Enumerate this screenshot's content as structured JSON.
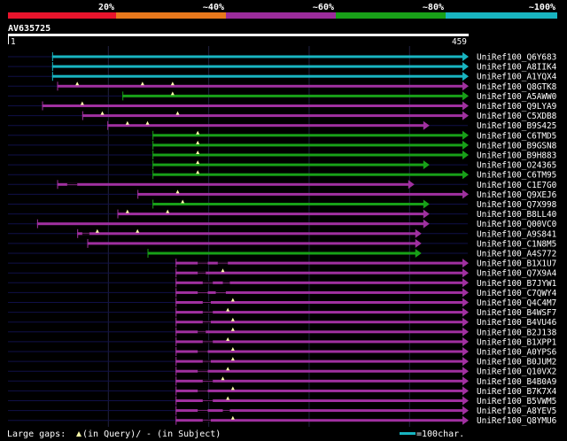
{
  "colors": {
    "background": "#000000",
    "bands": [
      "#e8142c",
      "#e8781c",
      "#9c2c9c",
      "#18a018",
      "#18b4c0"
    ],
    "hit_colors": {
      "cyan": "#18b4c0",
      "green": "#18a018",
      "purple": "#a030a0"
    },
    "track": "#101048",
    "gap_marker": "#ffffaa"
  },
  "identity_legend": [
    {
      "label": "20%",
      "color": "#e8142c"
    },
    {
      "label": "~40%",
      "color": "#e8781c"
    },
    {
      "label": "~60%",
      "color": "#9c2c9c"
    },
    {
      "label": "~80%",
      "color": "#18a018"
    },
    {
      "label": "~100%",
      "color": "#18b4c0"
    }
  ],
  "query": {
    "id": "AV635725",
    "start_label": "1",
    "end_label": "459",
    "length": 459
  },
  "footer": {
    "gaps_prefix": "Large gaps: ",
    "gaps_query_text": "(in Query)/",
    "gaps_subject_text": "- (in Subject)",
    "scale_text": "=100char."
  },
  "chart_data": {
    "type": "alignment",
    "x_axis": {
      "min": 1,
      "max": 459,
      "unit": "residue"
    },
    "hits": [
      {
        "name": "UniRef100_Q6Y683",
        "start": 45,
        "end": 459,
        "color": "cyan",
        "q_gaps": [],
        "s_gaps": []
      },
      {
        "name": "UniRef100_A8IIK4",
        "start": 45,
        "end": 459,
        "color": "cyan",
        "q_gaps": [],
        "s_gaps": []
      },
      {
        "name": "UniRef100_A1YQX4",
        "start": 45,
        "end": 459,
        "color": "cyan",
        "q_gaps": [],
        "s_gaps": []
      },
      {
        "name": "UniRef100_Q8GTK8",
        "start": 50,
        "end": 459,
        "color": "purple",
        "q_gaps": [
          70,
          135,
          165
        ],
        "s_gaps": []
      },
      {
        "name": "UniRef100_A5AWW0",
        "start": 115,
        "end": 459,
        "color": "green",
        "q_gaps": [
          165
        ],
        "s_gaps": []
      },
      {
        "name": "UniRef100_Q9LYA9",
        "start": 35,
        "end": 459,
        "color": "purple",
        "q_gaps": [
          75
        ],
        "s_gaps": []
      },
      {
        "name": "UniRef100_C5XDB8",
        "start": 75,
        "end": 459,
        "color": "purple",
        "q_gaps": [
          95,
          170
        ],
        "s_gaps": []
      },
      {
        "name": "UniRef100_B9S425",
        "start": 100,
        "end": 420,
        "color": "purple",
        "q_gaps": [
          120,
          140
        ],
        "s_gaps": []
      },
      {
        "name": "UniRef100_C6TMD5",
        "start": 145,
        "end": 459,
        "color": "green",
        "q_gaps": [
          190
        ],
        "s_gaps": []
      },
      {
        "name": "UniRef100_B9GSN8",
        "start": 145,
        "end": 459,
        "color": "green",
        "q_gaps": [
          190
        ],
        "s_gaps": []
      },
      {
        "name": "UniRef100_B9H883",
        "start": 145,
        "end": 459,
        "color": "green",
        "q_gaps": [
          190
        ],
        "s_gaps": []
      },
      {
        "name": "UniRef100_O24365",
        "start": 145,
        "end": 420,
        "color": "green",
        "q_gaps": [
          190
        ],
        "s_gaps": []
      },
      {
        "name": "UniRef100_C6TM95",
        "start": 145,
        "end": 459,
        "color": "green",
        "q_gaps": [
          190
        ],
        "s_gaps": []
      },
      {
        "name": "UniRef100_C1E7G0",
        "start": 50,
        "end": 405,
        "color": "purple",
        "q_gaps": [],
        "s_gaps": [
          [
            60,
            70
          ]
        ]
      },
      {
        "name": "UniRef100_Q9XEJ6",
        "start": 130,
        "end": 459,
        "color": "purple",
        "q_gaps": [
          170
        ],
        "s_gaps": []
      },
      {
        "name": "UniRef100_Q7X998",
        "start": 145,
        "end": 420,
        "color": "green",
        "q_gaps": [
          175
        ],
        "s_gaps": []
      },
      {
        "name": "UniRef100_B8LL40",
        "start": 110,
        "end": 420,
        "color": "purple",
        "q_gaps": [
          120,
          160
        ],
        "s_gaps": []
      },
      {
        "name": "UniRef100_Q00VC0",
        "start": 30,
        "end": 420,
        "color": "purple",
        "q_gaps": [],
        "s_gaps": []
      },
      {
        "name": "UniRef100_A9S841",
        "start": 70,
        "end": 412,
        "color": "purple",
        "q_gaps": [
          90,
          130
        ],
        "s_gaps": [
          [
            75,
            82
          ]
        ]
      },
      {
        "name": "UniRef100_C1N8M5",
        "start": 80,
        "end": 412,
        "color": "purple",
        "q_gaps": [],
        "s_gaps": []
      },
      {
        "name": "UniRef100_A4S772",
        "start": 140,
        "end": 412,
        "color": "green",
        "q_gaps": [],
        "s_gaps": []
      },
      {
        "name": "UniRef100_B1X1U7",
        "start": 168,
        "end": 459,
        "color": "purple",
        "q_gaps": [],
        "s_gaps": [
          [
            190,
            200
          ],
          [
            210,
            220
          ]
        ]
      },
      {
        "name": "UniRef100_Q7X9A4",
        "start": 168,
        "end": 459,
        "color": "purple",
        "q_gaps": [
          215
        ],
        "s_gaps": [
          [
            190,
            198
          ]
        ]
      },
      {
        "name": "UniRef100_B7JYW1",
        "start": 168,
        "end": 459,
        "color": "purple",
        "q_gaps": [],
        "s_gaps": [
          [
            195,
            205
          ],
          [
            215,
            222
          ]
        ]
      },
      {
        "name": "UniRef100_C7QWY4",
        "start": 168,
        "end": 459,
        "color": "purple",
        "q_gaps": [],
        "s_gaps": [
          [
            190,
            200
          ],
          [
            208,
            218
          ]
        ]
      },
      {
        "name": "UniRef100_Q4C4M7",
        "start": 168,
        "end": 459,
        "color": "purple",
        "q_gaps": [
          225
        ],
        "s_gaps": [
          [
            195,
            203
          ]
        ]
      },
      {
        "name": "UniRef100_B4WSF7",
        "start": 168,
        "end": 459,
        "color": "purple",
        "q_gaps": [
          220
        ],
        "s_gaps": [
          [
            195,
            205
          ]
        ]
      },
      {
        "name": "UniRef100_B4VU46",
        "start": 168,
        "end": 459,
        "color": "purple",
        "q_gaps": [
          225
        ],
        "s_gaps": [
          [
            195,
            203
          ]
        ]
      },
      {
        "name": "UniRef100_B2J138",
        "start": 168,
        "end": 459,
        "color": "purple",
        "q_gaps": [
          225
        ],
        "s_gaps": [
          [
            190,
            198
          ]
        ]
      },
      {
        "name": "UniRef100_B1XPP1",
        "start": 168,
        "end": 459,
        "color": "purple",
        "q_gaps": [
          220
        ],
        "s_gaps": [
          [
            195,
            205
          ]
        ]
      },
      {
        "name": "UniRef100_A0YPS6",
        "start": 168,
        "end": 459,
        "color": "purple",
        "q_gaps": [
          225
        ],
        "s_gaps": [
          [
            190,
            200
          ]
        ]
      },
      {
        "name": "UniRef100_B0JUM2",
        "start": 168,
        "end": 459,
        "color": "purple",
        "q_gaps": [
          225
        ],
        "s_gaps": [
          [
            195,
            203
          ]
        ]
      },
      {
        "name": "UniRef100_Q10VX2",
        "start": 168,
        "end": 459,
        "color": "purple",
        "q_gaps": [
          220
        ],
        "s_gaps": [
          [
            190,
            200
          ]
        ]
      },
      {
        "name": "UniRef100_B4B0A9",
        "start": 168,
        "end": 459,
        "color": "purple",
        "q_gaps": [
          215
        ],
        "s_gaps": [
          [
            195,
            205
          ]
        ]
      },
      {
        "name": "UniRef100_B7K7X4",
        "start": 168,
        "end": 459,
        "color": "purple",
        "q_gaps": [
          225
        ],
        "s_gaps": [
          [
            190,
            200
          ]
        ]
      },
      {
        "name": "UniRef100_B5VWM5",
        "start": 168,
        "end": 459,
        "color": "purple",
        "q_gaps": [
          220
        ],
        "s_gaps": [
          [
            195,
            205
          ]
        ]
      },
      {
        "name": "UniRef100_A8YEV5",
        "start": 168,
        "end": 459,
        "color": "purple",
        "q_gaps": [],
        "s_gaps": [
          [
            190,
            200
          ],
          [
            215,
            222
          ]
        ]
      },
      {
        "name": "UniRef100_Q8YMU6",
        "start": 168,
        "end": 459,
        "color": "purple",
        "q_gaps": [
          225
        ],
        "s_gaps": [
          [
            195,
            203
          ]
        ]
      }
    ]
  }
}
